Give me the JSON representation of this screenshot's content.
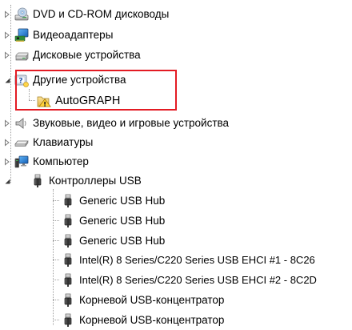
{
  "device_tree": {
    "categories": [
      {
        "label": "DVD и CD-ROM дисководы",
        "icon": "dvd-drive-icon",
        "expanded": false
      },
      {
        "label": "Видеоадаптеры",
        "icon": "display-adapter-icon",
        "expanded": false
      },
      {
        "label": "Дисковые устройства",
        "icon": "disk-drive-icon",
        "expanded": false
      },
      {
        "label": "Другие устройства",
        "icon": "unknown-device-icon",
        "expanded": true,
        "children": [
          {
            "label": "AutoGRAPH",
            "icon": "warning-device-icon"
          }
        ]
      },
      {
        "label": "Звуковые, видео и игровые устройства",
        "icon": "speaker-icon",
        "expanded": false
      },
      {
        "label": "Клавиатуры",
        "icon": "keyboard-icon",
        "expanded": false
      },
      {
        "label": "Компьютер",
        "icon": "computer-icon",
        "expanded": false
      },
      {
        "label": "Контроллеры USB",
        "icon": "usb-connector-icon",
        "expanded": true,
        "children": [
          {
            "label": "Generic USB Hub",
            "icon": "usb-connector-icon"
          },
          {
            "label": "Generic USB Hub",
            "icon": "usb-connector-icon"
          },
          {
            "label": "Generic USB Hub",
            "icon": "usb-connector-icon"
          },
          {
            "label": "Intel(R) 8 Series/C220 Series USB EHCI #1 - 8C26",
            "icon": "usb-connector-icon"
          },
          {
            "label": "Intel(R) 8 Series/C220 Series USB EHCI #2 - 8C2D",
            "icon": "usb-connector-icon"
          },
          {
            "label": "Корневой USB-концентратор",
            "icon": "usb-connector-icon"
          },
          {
            "label": "Корневой USB-концентратор",
            "icon": "usb-connector-icon"
          }
        ]
      }
    ]
  },
  "colors": {
    "highlight_border": "#e31b23",
    "tree_guide": "#a0a0a0",
    "expander": "#7a7a7a",
    "expander_open": "#3c3c3c"
  }
}
